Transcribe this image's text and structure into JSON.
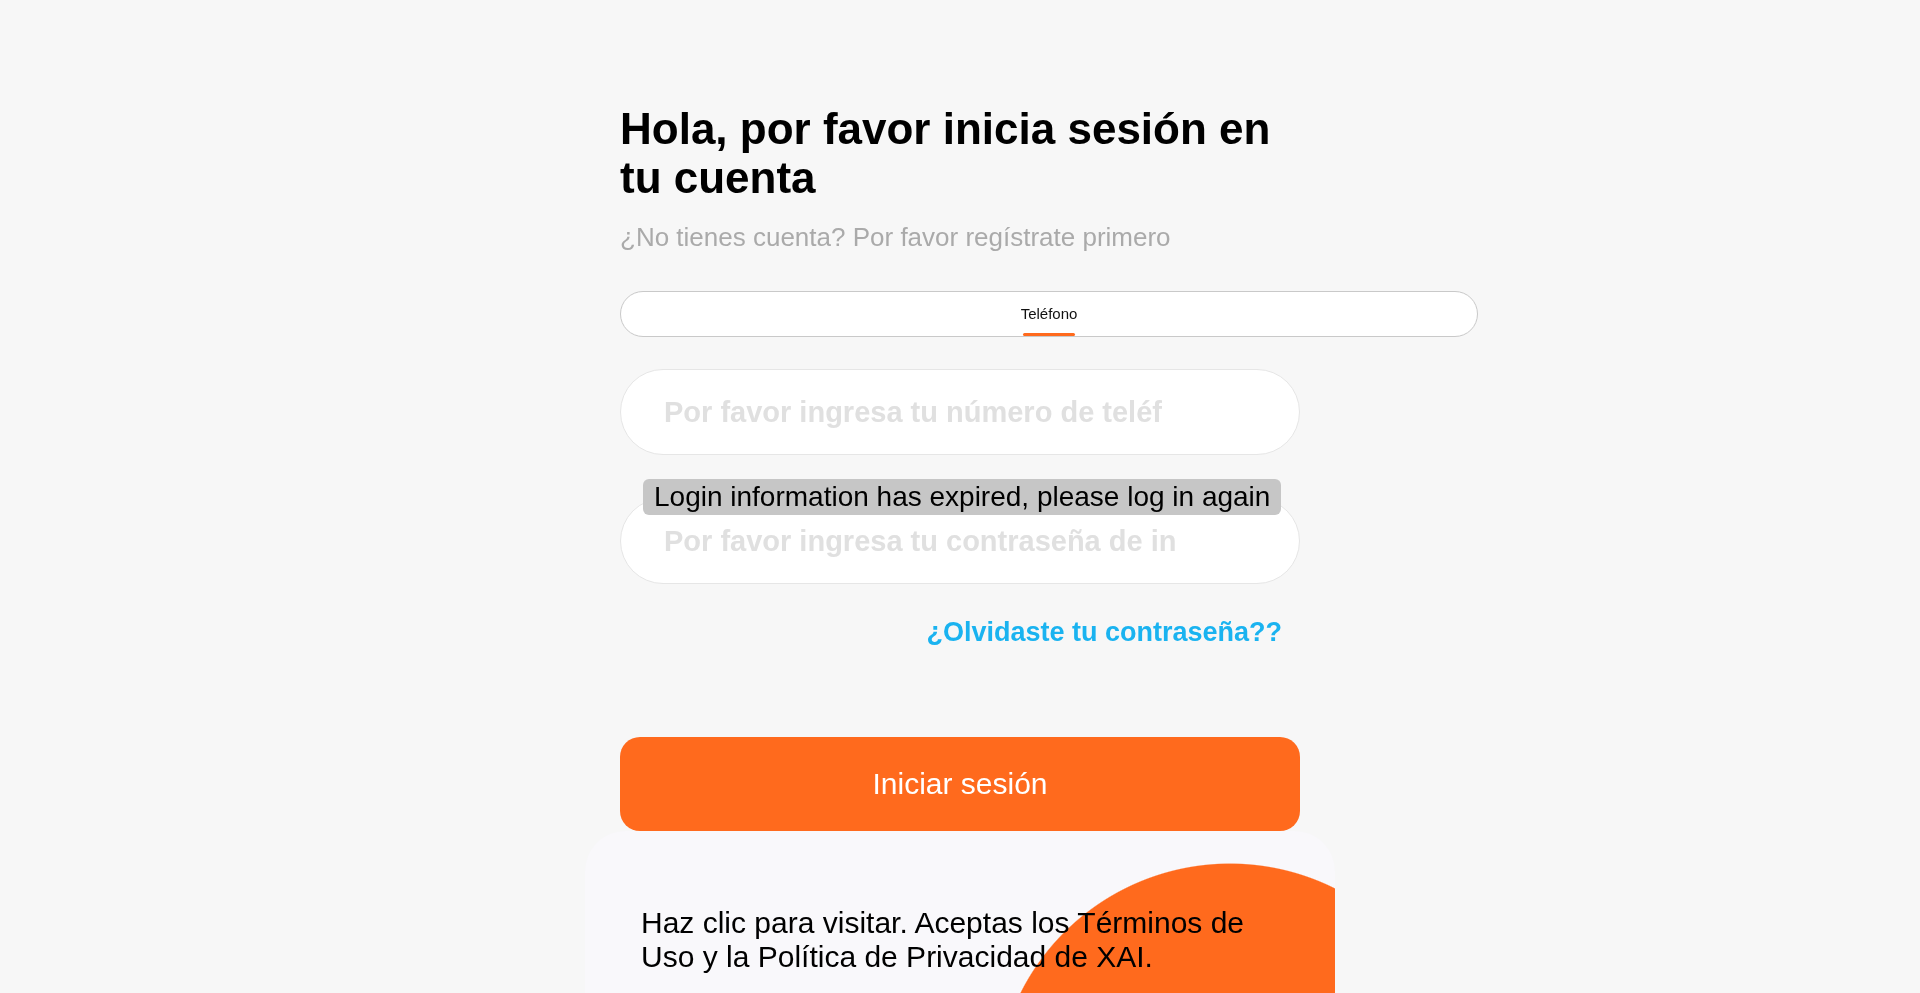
{
  "title": "Hola, por favor inicia sesión en tu cuenta",
  "subtitle": "¿No tienes cuenta? Por favor regístrate primero",
  "tabs": [
    {
      "label": "Teléfono",
      "selected": true
    }
  ],
  "fields": [
    {
      "placeholder": "Por favor ingresa tu número de teléf"
    },
    {
      "placeholder": "Por favor ingresa tu contraseña de in"
    }
  ],
  "toast": "Login information has expired, please log in again",
  "forgot_link": "¿Olvidaste tu contraseña??",
  "login_button": "Iniciar sesión",
  "footer_text": "Haz clic para visitar. Aceptas los Términos de Uso y la Política de Privacidad de XAI."
}
